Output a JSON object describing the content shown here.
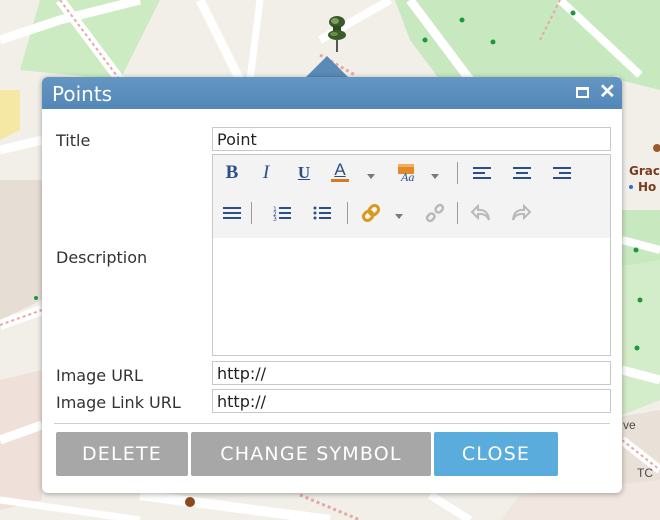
{
  "popup": {
    "title": "Points",
    "fields": {
      "title_label": "Title",
      "title_value": "Point",
      "description_label": "Description",
      "image_url_label": "Image URL",
      "image_url_value": "http://",
      "image_link_url_label": "Image Link URL",
      "image_link_url_value": "http://"
    },
    "buttons": {
      "delete": "DELETE",
      "change_symbol": "CHANGE SYMBOL",
      "close": "CLOSE"
    },
    "toolbar": {
      "bold": "B",
      "italic": "I",
      "underline": "U",
      "font_color": "A",
      "icons": [
        "bold-icon",
        "italic-icon",
        "underline-icon",
        "font-color-icon",
        "highlight-color-icon",
        "align-left-icon",
        "align-center-icon",
        "align-right-icon",
        "justify-icon",
        "ordered-list-icon",
        "unordered-list-icon",
        "link-icon",
        "unlink-icon",
        "undo-icon",
        "redo-icon"
      ]
    }
  },
  "map": {
    "labels": [
      "Grac",
      "Ho",
      "ve",
      "TC"
    ]
  },
  "colors": {
    "titlebar": "#5a8bb8",
    "close_button": "#59acdc",
    "gray_button": "#a7a7a7",
    "map_land": "#f2efe9",
    "map_park": "#c8e8c0"
  }
}
